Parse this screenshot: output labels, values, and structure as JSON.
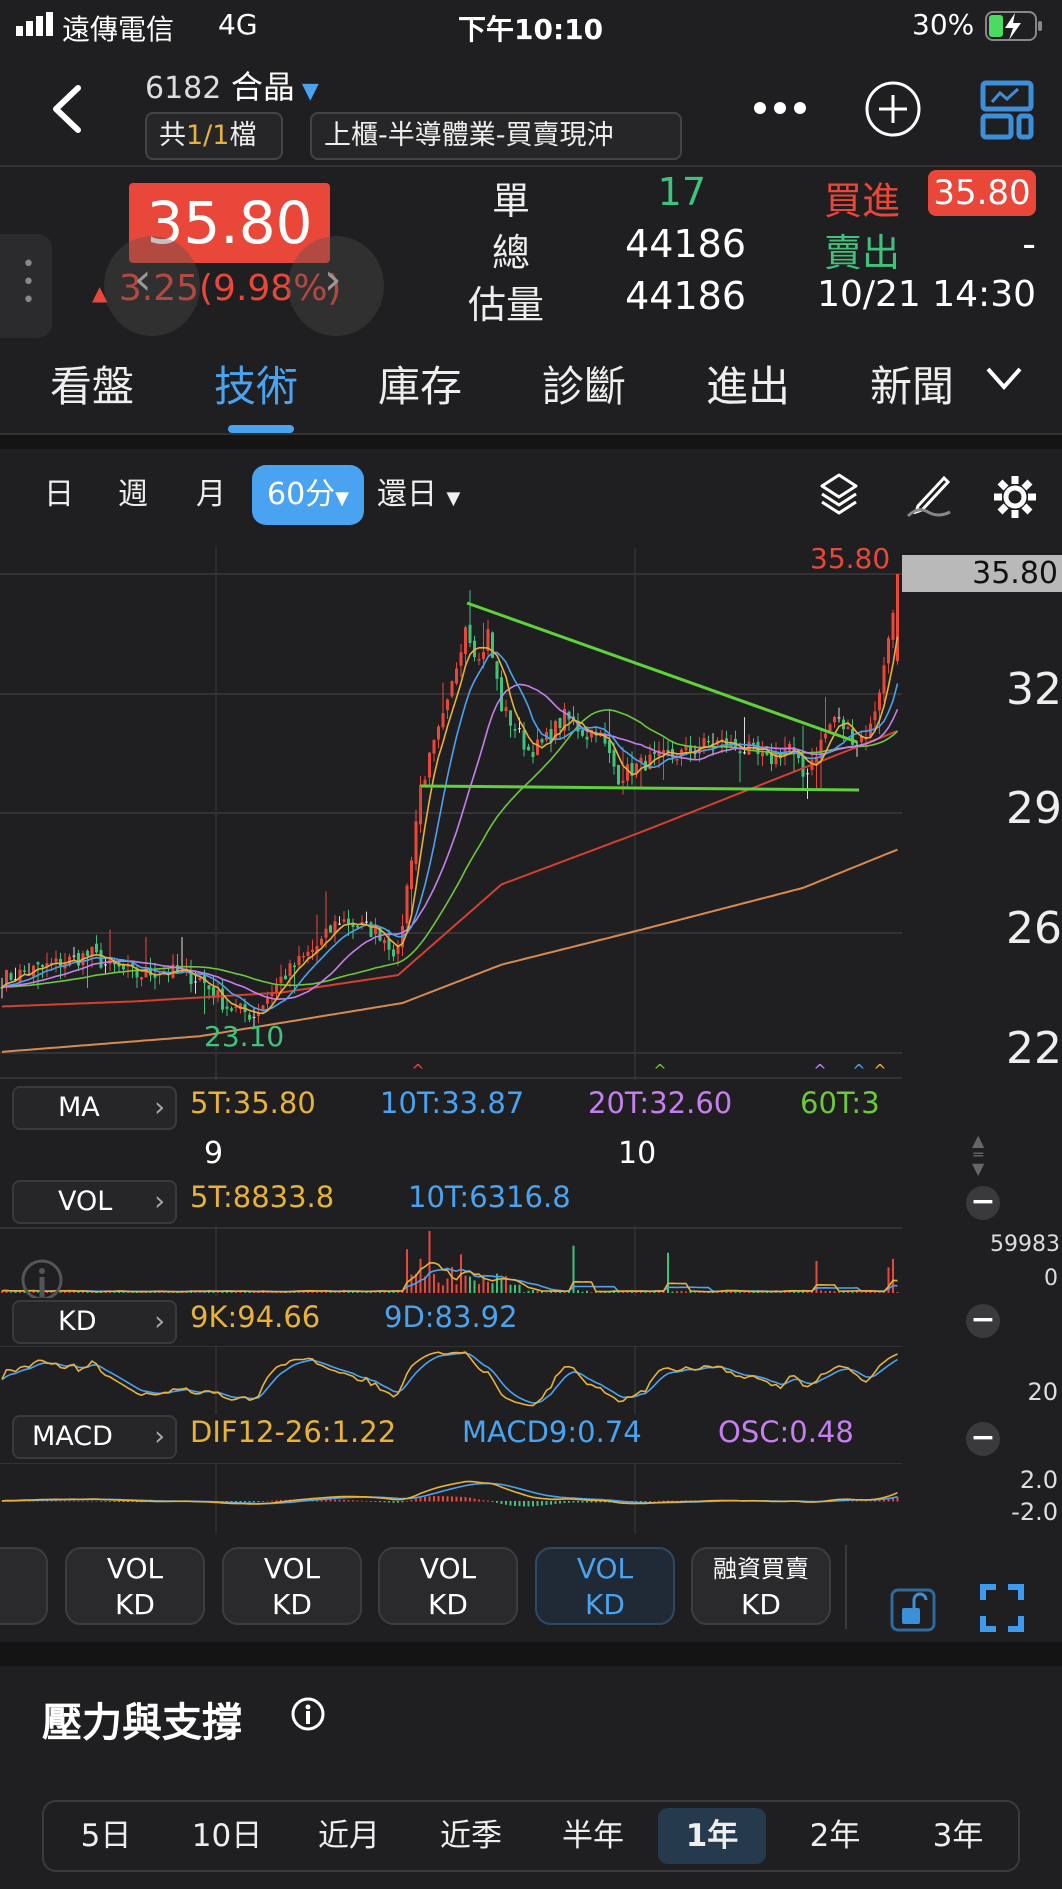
{
  "status_bar": {
    "carrier": "遠傳電信",
    "network": "4G",
    "time": "下午10:10",
    "battery": "30%"
  },
  "header": {
    "code": "6182",
    "name": "合晶",
    "file_prefix": "共",
    "file_count": "1/1",
    "file_suffix": "檔",
    "category": "上櫃-半導體業-買賣現沖"
  },
  "quote": {
    "price": "35.80",
    "change": "3.25(9.98%)",
    "single_label": "單",
    "single_value": "17",
    "total_label": "總",
    "total_value": "44186",
    "est_label": "估量",
    "est_value": "44186",
    "bid_label": "買進",
    "bid_value": "35.80",
    "ask_label": "賣出",
    "ask_value": "-",
    "datetime": "10/21 14:30"
  },
  "tabs": [
    {
      "label": "看盤"
    },
    {
      "label": "技術",
      "active": true
    },
    {
      "label": "庫存"
    },
    {
      "label": "診斷"
    },
    {
      "label": "進出"
    },
    {
      "label": "新聞"
    }
  ],
  "chart_toolbar": {
    "periods": [
      "日",
      "週",
      "月"
    ],
    "active_period": "60分",
    "restore": "還日"
  },
  "colors": {
    "up": "#e8473a",
    "down": "#3fc37a",
    "ma5": "#e8b23a",
    "ma10": "#4aa3f0",
    "ma20": "#c77ff0",
    "ma60": "#6cc93a",
    "accent": "#4aa3f0"
  },
  "chart_data": {
    "type": "candlestick",
    "last_price_label": "35.80",
    "high_label": "35.80",
    "low_label": "23.10",
    "y_tick_labels": [
      "32",
      "29",
      "26",
      "22"
    ],
    "x_tick_labels": [
      "9",
      "10"
    ],
    "close_path": [
      [
        0,
        24.2
      ],
      [
        20,
        24.9
      ],
      [
        23,
        24.6
      ],
      [
        30,
        24.3
      ],
      [
        36,
        24.45
      ],
      [
        44,
        24.2
      ],
      [
        50,
        23.4
      ],
      [
        56,
        23.15
      ],
      [
        62,
        24.2
      ],
      [
        71,
        25.25
      ],
      [
        75,
        25.9
      ],
      [
        84,
        25.5
      ],
      [
        88,
        24.9
      ],
      [
        90,
        26.8
      ],
      [
        93,
        29.7
      ],
      [
        99,
        32.0
      ],
      [
        103,
        34.4
      ],
      [
        106,
        33.3
      ],
      [
        108,
        34.1
      ],
      [
        111,
        32.0
      ],
      [
        117,
        30.75
      ],
      [
        120,
        30.9
      ],
      [
        125,
        31.7
      ],
      [
        130,
        31.2
      ],
      [
        132,
        31.4
      ],
      [
        137,
        30.0
      ],
      [
        143,
        30.4
      ],
      [
        151,
        30.65
      ],
      [
        158,
        31.0
      ],
      [
        166,
        30.75
      ],
      [
        170,
        30.4
      ],
      [
        175,
        30.9
      ],
      [
        178,
        30.0
      ],
      [
        185,
        31.7
      ],
      [
        190,
        31.0
      ],
      [
        193,
        31.4
      ],
      [
        196,
        33.1
      ],
      [
        199,
        35.8
      ]
    ],
    "ma_long_a": [
      [
        0,
        23.4
      ],
      [
        30,
        23.55
      ],
      [
        62,
        23.8
      ],
      [
        88,
        24.3
      ],
      [
        111,
        26.9
      ],
      [
        142,
        28.4
      ],
      [
        199,
        31.3
      ]
    ],
    "ma_long_b": [
      [
        0,
        22.1
      ],
      [
        44,
        22.55
      ],
      [
        89,
        23.5
      ],
      [
        111,
        24.6
      ],
      [
        142,
        25.6
      ],
      [
        178,
        26.8
      ],
      [
        199,
        27.9
      ]
    ],
    "ma": {
      "title": "MA",
      "items": [
        "5T:35.80",
        "10T:33.87",
        "20T:32.60",
        "60T:3"
      ]
    },
    "vol": {
      "title": "VOL",
      "items": [
        "5T:8833.8",
        "10T:6316.8"
      ],
      "max_label": "59983",
      "min_label": "0"
    },
    "kd": {
      "title": "KD",
      "items": [
        "9K:94.66",
        "9D:83.92"
      ],
      "tick_label": "20"
    },
    "macd": {
      "title": "MACD",
      "items": [
        "DIF12-26:1.22",
        "MACD9:0.74",
        "OSC:0.48"
      ],
      "tick_labels": [
        "2.0",
        "-2.0"
      ]
    }
  },
  "indicator_buttons": [
    {
      "top": "VOL",
      "bottom": "KD"
    },
    {
      "top": "VOL",
      "bottom": "KD"
    },
    {
      "top": "VOL",
      "bottom": "KD"
    },
    {
      "top": "VOL",
      "bottom": "KD",
      "active": true
    },
    {
      "top": "融資買賣",
      "bottom": "KD"
    }
  ],
  "support": {
    "title": "壓力與支撐",
    "ranges": [
      "5日",
      "10日",
      "近月",
      "近季",
      "半年",
      "1年",
      "2年",
      "3年"
    ],
    "active": "1年"
  }
}
